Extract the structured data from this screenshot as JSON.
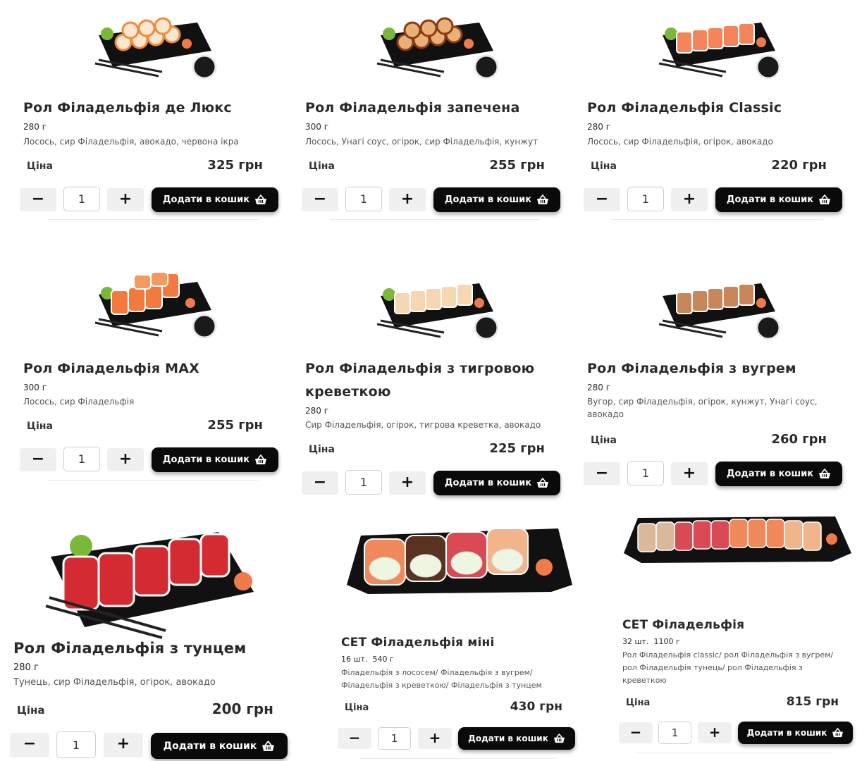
{
  "products": [
    {
      "title": "Рол Філадельфія де Люкс",
      "weight": "280 г",
      "description": "Лосось, сир Філадельфія, авокадо, червона ікра",
      "price_label": "Ціна",
      "price": "325 грн",
      "qty": "1",
      "minus": "−",
      "plus": "+",
      "cart_label": "Додати в кошик"
    },
    {
      "title": "Рол Філадельфія запечена",
      "weight": "300 г",
      "description": "Лосось, Унагі соус, огірок, сир Філадельфія, кунжут",
      "price_label": "Ціна",
      "price": "255 грн",
      "qty": "1",
      "minus": "−",
      "plus": "+",
      "cart_label": "Додати в кошик"
    },
    {
      "title": "Рол Філадельфія Classic",
      "weight": "280 г",
      "description": "Лосось, сир Філадельфія, огірок, авокадо",
      "price_label": "Ціна",
      "price": "220 грн",
      "qty": "1",
      "minus": "−",
      "plus": "+",
      "cart_label": "Додати в кошик"
    },
    {
      "title": "Рол Філадельфія MAX",
      "weight": "300 г",
      "description": "Лосось, сир Філадельфія",
      "price_label": "Ціна",
      "price": "255 грн",
      "qty": "1",
      "minus": "−",
      "plus": "+",
      "cart_label": "Додати в кошик"
    },
    {
      "title": "Рол Філадельфія з тигровою креветкою",
      "weight": "280 г",
      "description": "Сир Філадельфія, огірок, тигрова креветка, авокадо",
      "price_label": "Ціна",
      "price": "225 грн",
      "qty": "1",
      "minus": "−",
      "plus": "+",
      "cart_label": "Додати в кошик"
    },
    {
      "title": "Рол Філадельфія з вугрем",
      "weight": "280 г",
      "description": "Вугор, сир Філадельфія, огірок, кунжут, Унагі соус, авокадо",
      "price_label": "Ціна",
      "price": "260 грн",
      "qty": "1",
      "minus": "−",
      "plus": "+",
      "cart_label": "Додати в кошик"
    },
    {
      "title": "Рол Філадельфія з тунцем",
      "weight": "280 г",
      "description": "Тунець, сир Філадельфія, огірок, авокадо",
      "price_label": "Ціна",
      "price": "200 грн",
      "qty": "1",
      "minus": "−",
      "plus": "+",
      "cart_label": "Додати в кошик"
    },
    {
      "title": "СЕТ Філадельфія міні",
      "weight": "16 шт.  540 г",
      "description": "Філадельфія з лососем/ Філадельфія з вугрем/ Філадельфія з креветкою/ Філадельфія з тунцем",
      "price_label": "Ціна",
      "price": "430 грн",
      "qty": "1",
      "minus": "−",
      "plus": "+",
      "cart_label": "Додати в кошик"
    },
    {
      "title": "СЕТ Філадельфія",
      "weight": "32 шт.  1100 г",
      "description": "Рол Філадельфія classic/ рол Філадельфія з вугрем/ рол Філадельфія тунець/ рол Філадельфія з креветкою",
      "price_label": "Ціна",
      "price": "815 грн",
      "qty": "1",
      "minus": "−",
      "plus": "+",
      "cart_label": "Додати в кошик"
    }
  ],
  "icons": {
    "cart": "basket-icon",
    "product_image": "sushi-roll-image"
  },
  "colors": {
    "cart_button": "#0a0a0a",
    "qty_button": "#f0f0f0",
    "salmon": "#f08a5d",
    "plate": "#111111"
  }
}
